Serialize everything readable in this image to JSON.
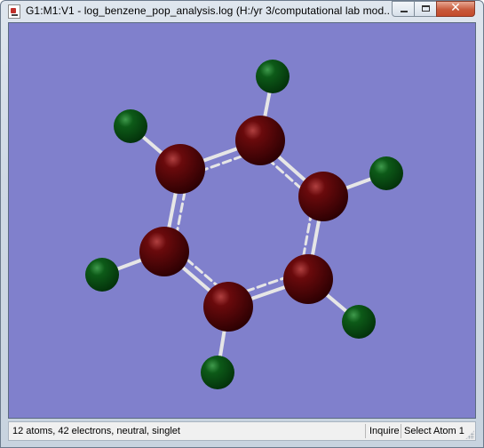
{
  "window": {
    "title": "G1:M1:V1 - log_benzene_pop_analysis.log (H:/yr 3/computational lab mod..."
  },
  "controls": {
    "minimize_icon": "minimize-icon",
    "maximize_icon": "restore-icon",
    "close_icon": "close-icon",
    "close_glyph": "✕"
  },
  "viewer": {
    "background_color": "#8080cc",
    "carbon_color": "#4a0406",
    "hydrogen_color": "#0a4d14",
    "bond_color": "#e6e6e6",
    "molecule": "benzene",
    "carbon_count": 6,
    "hydrogen_count": 6
  },
  "status": {
    "summary": "12 atoms, 42 electrons, neutral, singlet",
    "mode": "Inquire",
    "selection": "Select Atom 1"
  }
}
